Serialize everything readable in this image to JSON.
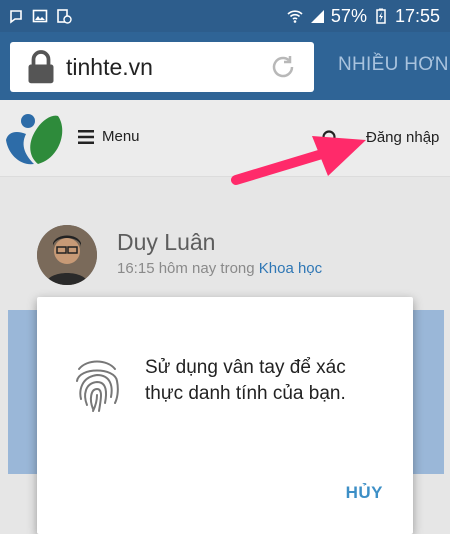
{
  "status_bar": {
    "battery": "57%",
    "time": "17:55",
    "icons": [
      "notification-icon",
      "image-icon",
      "alarm-icon",
      "wifi-icon",
      "signal-icon",
      "battery-icon"
    ]
  },
  "browser": {
    "url": "tinhte.vn",
    "more_label": "NHIỀU HƠN"
  },
  "header": {
    "menu_label": "Menu",
    "login_label": "Đăng nhập"
  },
  "post": {
    "author": "Duy Luân",
    "time_prefix": "16:15 hôm nay trong ",
    "category": "Khoa học"
  },
  "dialog": {
    "message": "Sử dụng vân tay để xác thực danh tính của bạn.",
    "cancel_label": "HỦY"
  },
  "colors": {
    "status_bar": "#2d5d8c",
    "toolbar": "#2f6496",
    "arrow": "#ff2a6a",
    "accent": "#3d8fc6"
  }
}
